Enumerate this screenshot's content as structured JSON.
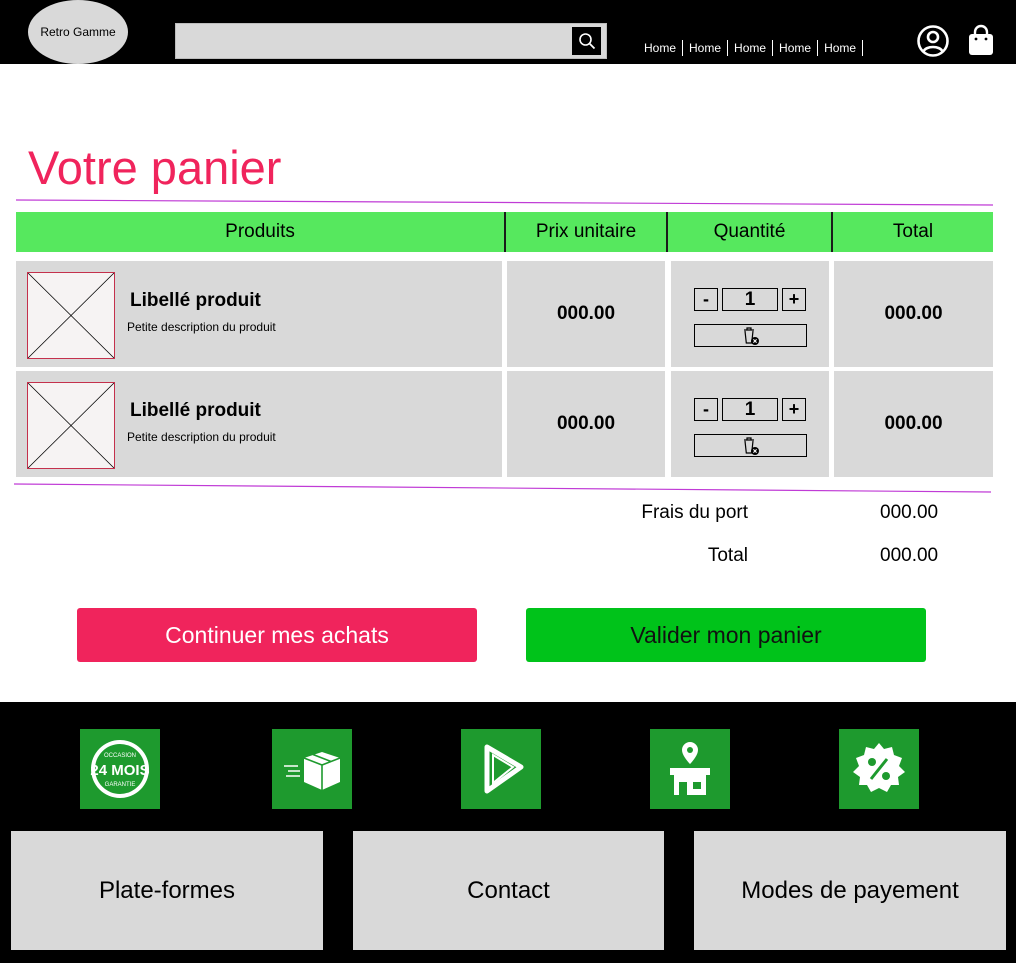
{
  "header": {
    "logo_text": "Retro Gamme",
    "search": {
      "value": "",
      "icon": "search-icon"
    },
    "nav_items": [
      "Home",
      "Home",
      "Home",
      "Home",
      "Home"
    ],
    "icons": {
      "account": "user-circle-icon",
      "cart": "shopping-bag-icon"
    }
  },
  "cart": {
    "title": "Votre panier",
    "columns": [
      "Produits",
      "Prix unitaire",
      "Quantité",
      "Total"
    ],
    "rows": [
      {
        "name": "Libellé produit",
        "description": "Petite description du produit",
        "unit_price": "000.00",
        "quantity": "1",
        "total": "000.00"
      },
      {
        "name": "Libellé produit",
        "description": "Petite description du produit",
        "unit_price": "000.00",
        "quantity": "1",
        "total": "000.00"
      }
    ],
    "qty_minus": "-",
    "qty_plus": "+",
    "remove_icon": "trash-remove-icon",
    "summary": {
      "shipping_label": "Frais du port",
      "shipping_value": "000.00",
      "total_label": "Total",
      "total_value": "000.00"
    },
    "buttons": {
      "continue": "Continuer mes achats",
      "validate": "Valider mon panier"
    }
  },
  "footer": {
    "features": [
      {
        "icon": "warranty-24-months-badge-icon",
        "badge_text": "24 MOIS",
        "badge_top": "OCCASION",
        "badge_bottom": "GARANTIE"
      },
      {
        "icon": "fast-delivery-box-icon"
      },
      {
        "icon": "recycle-triangle-icon"
      },
      {
        "icon": "store-location-icon"
      },
      {
        "icon": "discount-percent-icon"
      }
    ],
    "links": [
      "Plate-formes",
      "Contact",
      "Modes de payement"
    ]
  },
  "colors": {
    "accent": "#f0245c",
    "header_green": "#56e85e",
    "validate_green": "#00c31a",
    "feature_green": "#1e9a2e",
    "cell_gray": "#d9d9d9",
    "divider_purple": "#c03bd6"
  }
}
